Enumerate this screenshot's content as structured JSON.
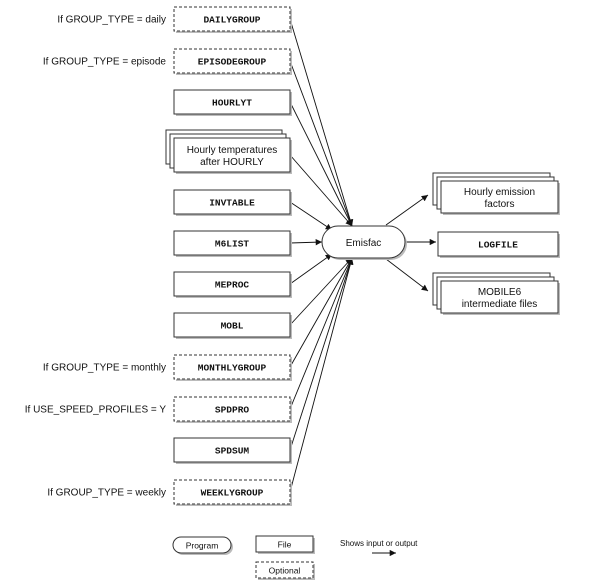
{
  "inputs": [
    {
      "label": "DAILYGROUP",
      "mono": true,
      "optional": true,
      "condition": "If GROUP_TYPE = daily"
    },
    {
      "label": "EPISODEGROUP",
      "mono": true,
      "optional": true,
      "condition": "If GROUP_TYPE = episode"
    },
    {
      "label": "HOURLYT",
      "mono": true,
      "optional": false
    },
    {
      "label": "Hourly temperatures",
      "label2": "after HOURLY",
      "stack": true,
      "optional": false
    },
    {
      "label": "INVTABLE",
      "mono": true,
      "optional": false
    },
    {
      "label": "M6LIST",
      "mono": true,
      "optional": false
    },
    {
      "label": "MEPROC",
      "mono": true,
      "optional": false
    },
    {
      "label": "MOBL",
      "mono": true,
      "optional": false
    },
    {
      "label": "MONTHLYGROUP",
      "mono": true,
      "optional": true,
      "condition": "If GROUP_TYPE = monthly"
    },
    {
      "label": "SPDPRO",
      "mono": true,
      "optional": true,
      "condition": "If USE_SPEED_PROFILES = Y"
    },
    {
      "label": "SPDSUM",
      "mono": true,
      "optional": false
    },
    {
      "label": "WEEKLYGROUP",
      "mono": true,
      "optional": true,
      "condition": "If GROUP_TYPE = weekly"
    }
  ],
  "program": {
    "label": "Emisfac"
  },
  "outputs": [
    {
      "label": "Hourly emission",
      "label2": "factors",
      "stack": true
    },
    {
      "label": "LOGFILE",
      "mono": true
    },
    {
      "label": "MOBILE6",
      "label2": "intermediate files",
      "stack": true
    }
  ],
  "legend": {
    "program": "Program",
    "file": "File",
    "optional": "Optional",
    "arrow": "Shows input or output"
  }
}
